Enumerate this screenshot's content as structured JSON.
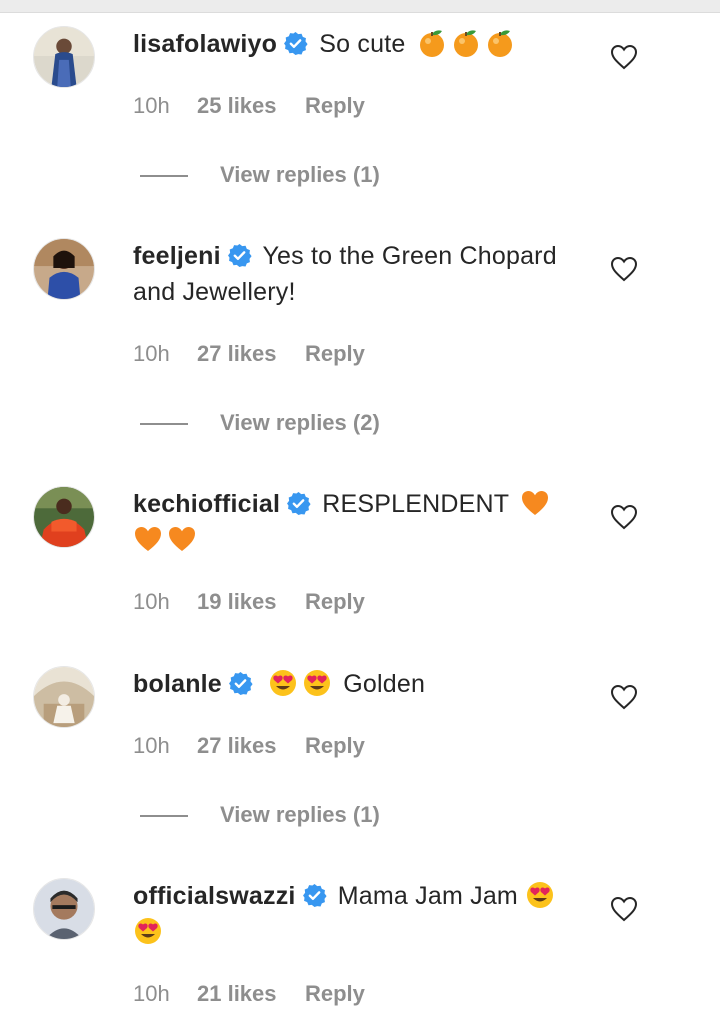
{
  "comments": [
    {
      "username": "lisafolawiyo",
      "text": "So cute",
      "emojis": [
        "tangerine",
        "tangerine",
        "tangerine"
      ],
      "trailing_emojis": [],
      "time": "10h",
      "likes": "25 likes",
      "reply": "Reply",
      "view_replies": "View replies (1)"
    },
    {
      "username": "feeljeni",
      "text": "Yes to the Green Chopard and Jewellery!",
      "time": "10h",
      "likes": "27 likes",
      "reply": "Reply",
      "view_replies": "View replies (2)"
    },
    {
      "username": "kechiofficial",
      "text": "RESPLENDENT",
      "emojis": [
        "orange-heart",
        "orange-heart",
        "orange-heart"
      ],
      "time": "10h",
      "likes": "19 likes",
      "reply": "Reply"
    },
    {
      "username": "bolanle",
      "text": "Golden",
      "emojis": [
        "heart-eyes",
        "heart-eyes"
      ],
      "time": "10h",
      "likes": "27 likes",
      "reply": "Reply",
      "view_replies": "View replies (1)"
    },
    {
      "username": "officialswazzi",
      "text": "Mama Jam Jam",
      "emojis": [
        "heart-eyes",
        "heart-eyes"
      ],
      "time": "10h",
      "likes": "21 likes",
      "reply": "Reply"
    }
  ],
  "colors": {
    "text": "#262626",
    "muted": "#8e8e8e",
    "verified": "#3897f0",
    "background": "#ffffff"
  }
}
